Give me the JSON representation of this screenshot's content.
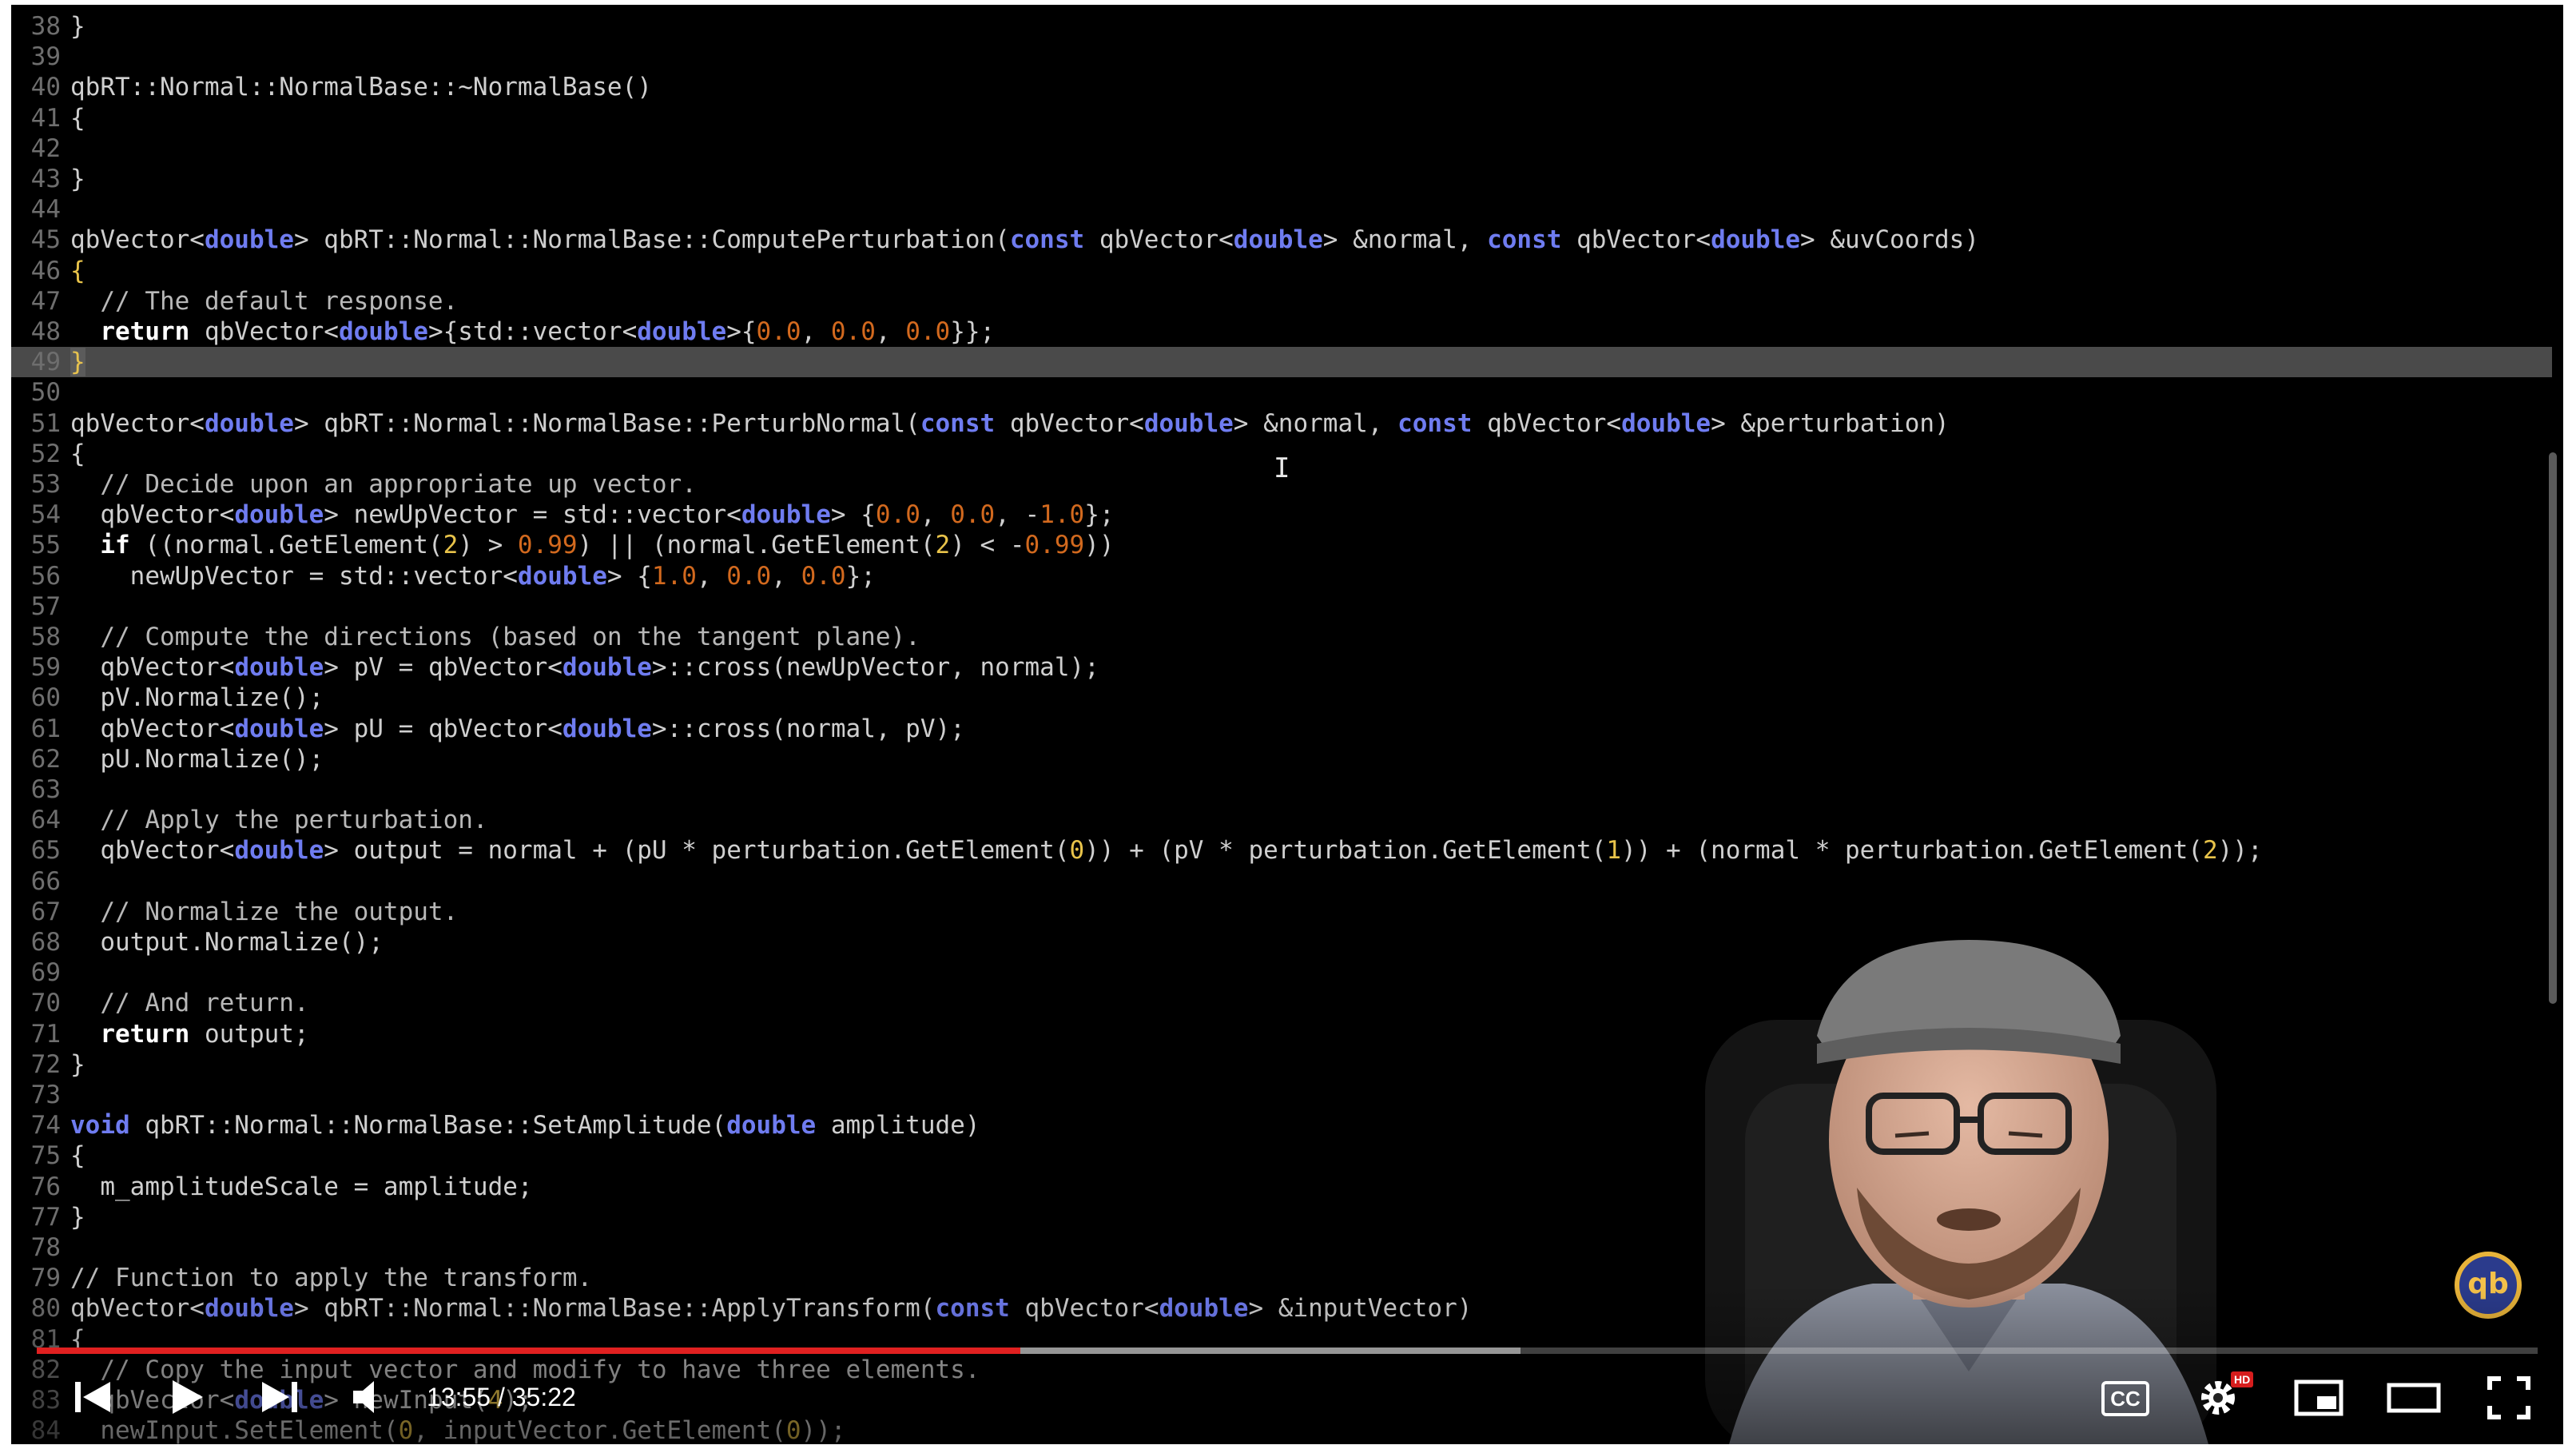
{
  "code_lines": [
    {
      "n": "38",
      "segs": [
        [
          "}",
          ""
        ]
      ]
    },
    {
      "n": "39",
      "segs": []
    },
    {
      "n": "40",
      "segs": [
        [
          "qbRT::Normal::NormalBase::~NormalBase()",
          ""
        ]
      ]
    },
    {
      "n": "41",
      "segs": [
        [
          "{",
          ""
        ]
      ]
    },
    {
      "n": "42",
      "segs": []
    },
    {
      "n": "43",
      "segs": [
        [
          "}",
          ""
        ]
      ]
    },
    {
      "n": "44",
      "segs": []
    },
    {
      "n": "45",
      "segs": [
        [
          "qbVector<",
          ""
        ],
        [
          "double",
          "kw"
        ],
        [
          "> qbRT::Normal::NormalBase::ComputePerturbation(",
          ""
        ],
        [
          "const",
          "kw"
        ],
        [
          " qbVector<",
          ""
        ],
        [
          "double",
          "kw"
        ],
        [
          "> &normal, ",
          ""
        ],
        [
          "const",
          "kw"
        ],
        [
          " qbVector<",
          ""
        ],
        [
          "double",
          "kw"
        ],
        [
          "> &uvCoords)",
          ""
        ]
      ]
    },
    {
      "n": "46",
      "segs": [
        [
          "{",
          "numy"
        ]
      ]
    },
    {
      "n": "47",
      "segs": [
        [
          "  // The default response.",
          "cm"
        ]
      ]
    },
    {
      "n": "48",
      "segs": [
        [
          "  ",
          ""
        ],
        [
          "return",
          "kwb"
        ],
        [
          " qbVector<",
          ""
        ],
        [
          "double",
          "kw"
        ],
        [
          ">{std::vector<",
          ""
        ],
        [
          "double",
          "kw"
        ],
        [
          ">{",
          ""
        ],
        [
          "0.0",
          "num"
        ],
        [
          ", ",
          ""
        ],
        [
          "0.0",
          "num"
        ],
        [
          ", ",
          ""
        ],
        [
          "0.0",
          "num"
        ],
        [
          "}};",
          ""
        ]
      ]
    },
    {
      "n": "49",
      "segs": [
        [
          "}",
          "br"
        ]
      ],
      "current": true
    },
    {
      "n": "50",
      "segs": []
    },
    {
      "n": "51",
      "segs": [
        [
          "qbVector<",
          ""
        ],
        [
          "double",
          "kw"
        ],
        [
          "> qbRT::Normal::NormalBase::PerturbNormal(",
          ""
        ],
        [
          "const",
          "kw"
        ],
        [
          " qbVector<",
          ""
        ],
        [
          "double",
          "kw"
        ],
        [
          "> &normal, ",
          ""
        ],
        [
          "const",
          "kw"
        ],
        [
          " qbVector<",
          ""
        ],
        [
          "double",
          "kw"
        ],
        [
          "> &perturbation)",
          ""
        ]
      ]
    },
    {
      "n": "52",
      "segs": [
        [
          "{",
          ""
        ]
      ]
    },
    {
      "n": "53",
      "segs": [
        [
          "  // Decide upon an appropriate up vector.",
          "cm"
        ]
      ]
    },
    {
      "n": "54",
      "segs": [
        [
          "  qbVector<",
          ""
        ],
        [
          "double",
          "kw"
        ],
        [
          "> newUpVector = std::vector<",
          ""
        ],
        [
          "double",
          "kw"
        ],
        [
          "> {",
          ""
        ],
        [
          "0.0",
          "num"
        ],
        [
          ", ",
          ""
        ],
        [
          "0.0",
          "num"
        ],
        [
          ", -",
          ""
        ],
        [
          "1.0",
          "num"
        ],
        [
          "};",
          ""
        ]
      ]
    },
    {
      "n": "55",
      "segs": [
        [
          "  ",
          ""
        ],
        [
          "if",
          "kwb"
        ],
        [
          " ((normal.GetElement(",
          ""
        ],
        [
          "2",
          "numy"
        ],
        [
          ") > ",
          ""
        ],
        [
          "0.99",
          "num"
        ],
        [
          ") || (normal.GetElement(",
          ""
        ],
        [
          "2",
          "numy"
        ],
        [
          ") < -",
          ""
        ],
        [
          "0.99",
          "num"
        ],
        [
          "))",
          ""
        ]
      ]
    },
    {
      "n": "56",
      "segs": [
        [
          "    newUpVector = std::vector<",
          ""
        ],
        [
          "double",
          "kw"
        ],
        [
          "> {",
          ""
        ],
        [
          "1.0",
          "num"
        ],
        [
          ", ",
          ""
        ],
        [
          "0.0",
          "num"
        ],
        [
          ", ",
          ""
        ],
        [
          "0.0",
          "num"
        ],
        [
          "};",
          ""
        ]
      ]
    },
    {
      "n": "57",
      "segs": []
    },
    {
      "n": "58",
      "segs": [
        [
          "  // Compute the directions (based on the tangent plane).",
          "cm"
        ]
      ]
    },
    {
      "n": "59",
      "segs": [
        [
          "  qbVector<",
          ""
        ],
        [
          "double",
          "kw"
        ],
        [
          "> pV = qbVector<",
          ""
        ],
        [
          "double",
          "kw"
        ],
        [
          ">::cross(newUpVector, normal);",
          ""
        ]
      ]
    },
    {
      "n": "60",
      "segs": [
        [
          "  pV.Normalize();",
          ""
        ]
      ]
    },
    {
      "n": "61",
      "segs": [
        [
          "  qbVector<",
          ""
        ],
        [
          "double",
          "kw"
        ],
        [
          "> pU = qbVector<",
          ""
        ],
        [
          "double",
          "kw"
        ],
        [
          ">::cross(normal, pV);",
          ""
        ]
      ]
    },
    {
      "n": "62",
      "segs": [
        [
          "  pU.Normalize();",
          ""
        ]
      ]
    },
    {
      "n": "63",
      "segs": []
    },
    {
      "n": "64",
      "segs": [
        [
          "  // Apply the perturbation.",
          "cm"
        ]
      ]
    },
    {
      "n": "65",
      "segs": [
        [
          "  qbVector<",
          ""
        ],
        [
          "double",
          "kw"
        ],
        [
          "> output = normal + (pU * perturbation.GetElement(",
          ""
        ],
        [
          "0",
          "numy"
        ],
        [
          ")) + (pV * perturbation.GetElement(",
          ""
        ],
        [
          "1",
          "numy"
        ],
        [
          ")) + (normal * perturbation.GetElement(",
          ""
        ],
        [
          "2",
          "numy"
        ],
        [
          "));",
          ""
        ]
      ]
    },
    {
      "n": "66",
      "segs": []
    },
    {
      "n": "67",
      "segs": [
        [
          "  // Normalize the output.",
          "cm"
        ]
      ]
    },
    {
      "n": "68",
      "segs": [
        [
          "  output.Normalize();",
          ""
        ]
      ]
    },
    {
      "n": "69",
      "segs": []
    },
    {
      "n": "70",
      "segs": [
        [
          "  // And return.",
          "cm"
        ]
      ]
    },
    {
      "n": "71",
      "segs": [
        [
          "  ",
          ""
        ],
        [
          "return",
          "kwb"
        ],
        [
          " output;",
          ""
        ]
      ]
    },
    {
      "n": "72",
      "segs": [
        [
          "}",
          ""
        ]
      ]
    },
    {
      "n": "73",
      "segs": []
    },
    {
      "n": "74",
      "segs": [
        [
          "void",
          "kw"
        ],
        [
          " qbRT::Normal::NormalBase::SetAmplitude(",
          ""
        ],
        [
          "double",
          "kw"
        ],
        [
          " amplitude)",
          ""
        ]
      ]
    },
    {
      "n": "75",
      "segs": [
        [
          "{",
          ""
        ]
      ]
    },
    {
      "n": "76",
      "segs": [
        [
          "  m_amplitudeScale = amplitude;",
          ""
        ]
      ]
    },
    {
      "n": "77",
      "segs": [
        [
          "}",
          ""
        ]
      ]
    },
    {
      "n": "78",
      "segs": []
    },
    {
      "n": "79",
      "segs": [
        [
          "// Function to apply the transform.",
          "cm"
        ]
      ]
    },
    {
      "n": "80",
      "segs": [
        [
          "qbVector<",
          ""
        ],
        [
          "double",
          "kw"
        ],
        [
          "> qbRT::Normal::NormalBase::ApplyTransform(",
          ""
        ],
        [
          "const",
          "kw"
        ],
        [
          " qbVector<",
          ""
        ],
        [
          "double",
          "kw"
        ],
        [
          "> &inputVector)",
          ""
        ]
      ]
    },
    {
      "n": "81",
      "segs": [
        [
          "{",
          ""
        ]
      ]
    },
    {
      "n": "82",
      "segs": [
        [
          "  // Copy the input vector and modify to have three elements.",
          "cm"
        ]
      ]
    },
    {
      "n": "83",
      "segs": [
        [
          "  qbVector<",
          ""
        ],
        [
          "double",
          "kw"
        ],
        [
          "> newInput(",
          ""
        ],
        [
          "4",
          "numy"
        ],
        [
          ");",
          ""
        ]
      ]
    },
    {
      "n": "84",
      "segs": [
        [
          "  newInput.SetElement(",
          ""
        ],
        [
          "0",
          "numy"
        ],
        [
          ", inputVector.GetElement(",
          ""
        ],
        [
          "0",
          "numy"
        ],
        [
          "));",
          ""
        ]
      ]
    }
  ],
  "player": {
    "current_time": "13:55",
    "separator": " / ",
    "duration": "35:22",
    "played_fraction": 0.3934,
    "buffered_fraction": 0.2,
    "hd_badge": "HD",
    "cc_label": "CC",
    "icons": {
      "prev": "previous-icon",
      "play": "play-icon",
      "next": "next-icon",
      "volume": "volume-icon",
      "settings": "gear-icon",
      "miniplayer": "miniplayer-icon",
      "theater": "theater-icon",
      "fullscreen": "fullscreen-icon"
    },
    "accent_color": "#e02020"
  },
  "channel_logo_text": "qb"
}
